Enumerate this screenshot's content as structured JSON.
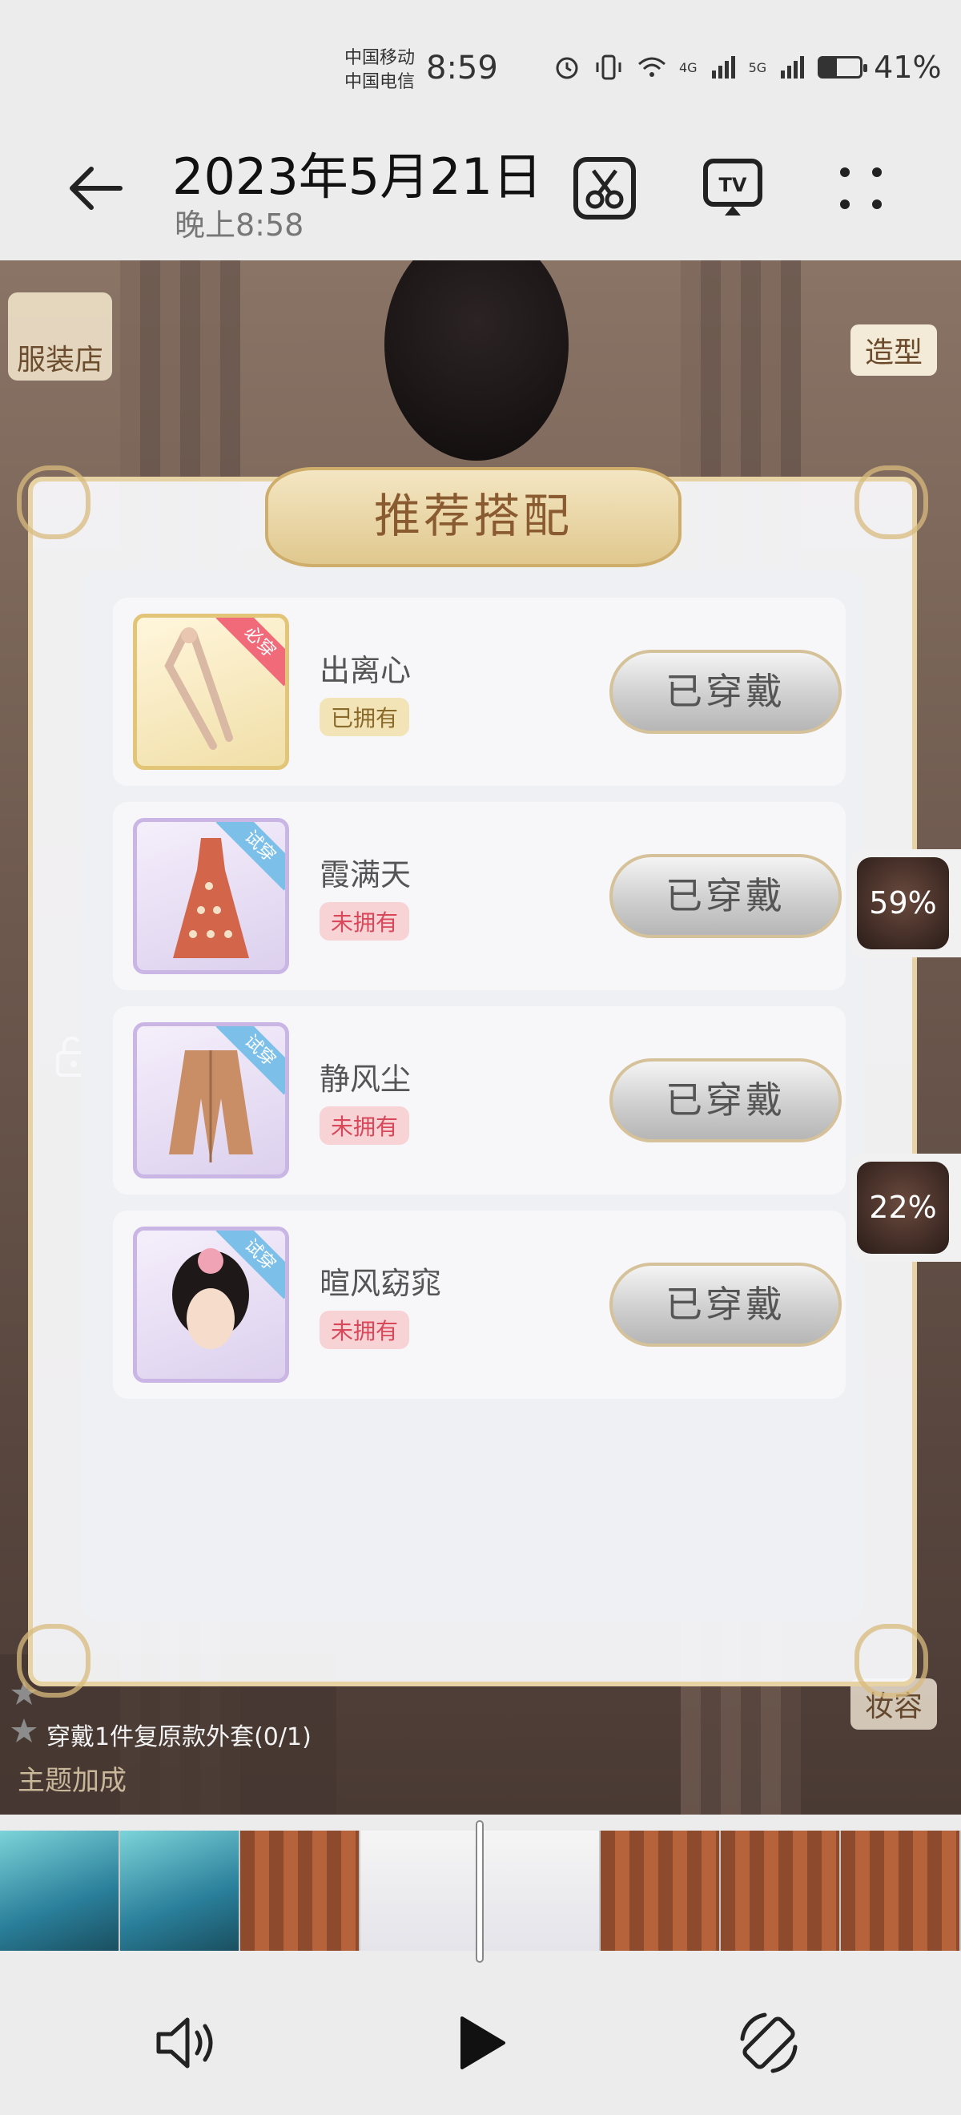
{
  "status_bar": {
    "carrier_1": "中国移动",
    "carrier_2": "中国电信",
    "time": "8:59",
    "network_1": "4G",
    "network_2": "5G",
    "battery_percent": "41%"
  },
  "header": {
    "date": "2023年5月21日",
    "time": "晚上8:58",
    "icons": [
      "back-arrow-icon",
      "scissors-icon",
      "tv-icon",
      "more-icon"
    ]
  },
  "game": {
    "shop_label": "服装店",
    "style_label": "造型",
    "makeup_label": "妆容",
    "panel_title": "推荐搭配",
    "items": [
      {
        "name": "出离心",
        "status": "已拥有",
        "tag": "必穿",
        "button": "已穿戴"
      },
      {
        "name": "霞满天",
        "status": "未拥有",
        "tag": "试穿",
        "button": "已穿戴"
      },
      {
        "name": "静风尘",
        "status": "未拥有",
        "tag": "试穿",
        "button": "已穿戴"
      },
      {
        "name": "暄风窈窕",
        "status": "未拥有",
        "tag": "试穿",
        "button": "已穿戴"
      }
    ],
    "float_1": "59%",
    "float_2": "22%",
    "quest_line": "穿戴1件复原款外套(0/1)",
    "quest_head": "主题加成"
  },
  "player": {
    "controls": [
      "volume-icon",
      "play-icon",
      "rotate-icon"
    ]
  },
  "colors": {
    "accent_gold": "#e6d2a2",
    "owned_badge": "#f3e4b8",
    "not_owned_badge": "#f8d3d6"
  }
}
